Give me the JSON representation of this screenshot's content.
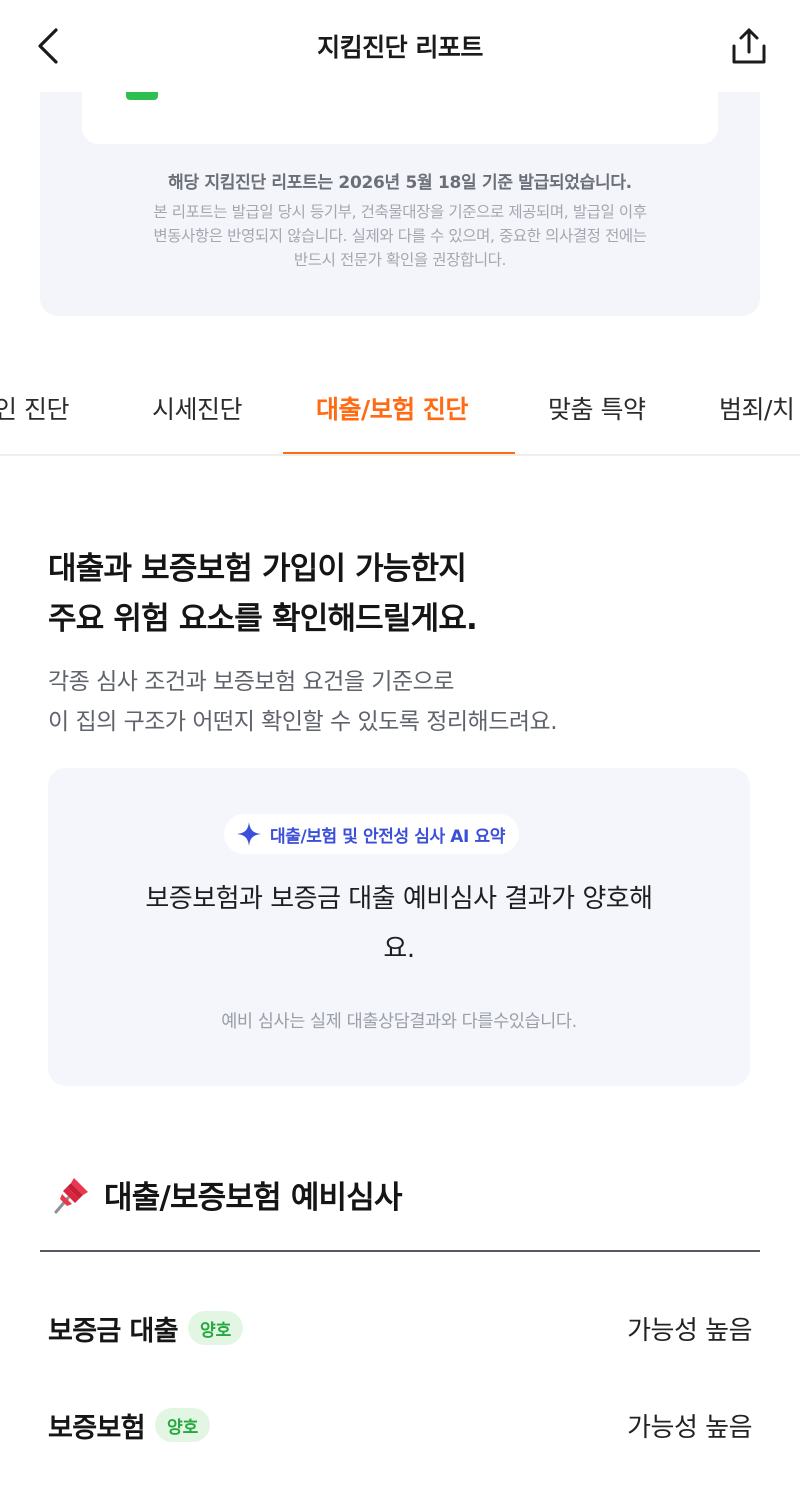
{
  "header": {
    "title": "지킴진단 리포트"
  },
  "notice": {
    "issued": "해당 지킴진단 리포트는 2026년 5월 18일 기준 발급되었습니다.",
    "body_line1": "본 리포트는 발급일 당시 등기부, 건축물대장을 기준으로 제공되며, 발급일 이후",
    "body_line2": "변동사항은 반영되지 않습니다. 실제와 다를 수 있으며, 중요한 의사결정 전에는",
    "body_line3": "반드시 전문가 확인을 권장합니다."
  },
  "tabs": [
    {
      "label": "인 진단"
    },
    {
      "label": "시세진단"
    },
    {
      "label": "대출/보험 진단"
    },
    {
      "label": "맞춤 특약"
    },
    {
      "label": "범죄/치"
    }
  ],
  "active_tab_index": 2,
  "intro": {
    "title_line1": "대출과 보증보험 가입이 가능한지",
    "title_line2": "주요 위험 요소를 확인해드릴게요.",
    "desc_line1": "각종 심사 조건과 보증보험 요건을 기준으로",
    "desc_line2": "이 집의 구조가 어떤지 확인할 수 있도록 정리해드려요."
  },
  "ai_summary": {
    "chip_label": "대출/보험 및 안전성 심사 AI 요약",
    "summary_line1": "보증보험과 보증금 대출 예비심사 결과가 양호해",
    "summary_line2": "요.",
    "note": "예비 심사는 실제 대출상담결과와 다를수있습니다."
  },
  "section": {
    "title": "대출/보증보험 예비심사",
    "icon": "pushpin-icon"
  },
  "rows": [
    {
      "label": "보증금 대출",
      "badge": "양호",
      "value": "가능성 높음"
    },
    {
      "label": "보증보험",
      "badge": "양호",
      "value": "가능성 높음"
    }
  ],
  "colors": {
    "accent": "#ff6a13",
    "ai_blue": "#3b4fd8",
    "good_green": "#24a83f"
  }
}
